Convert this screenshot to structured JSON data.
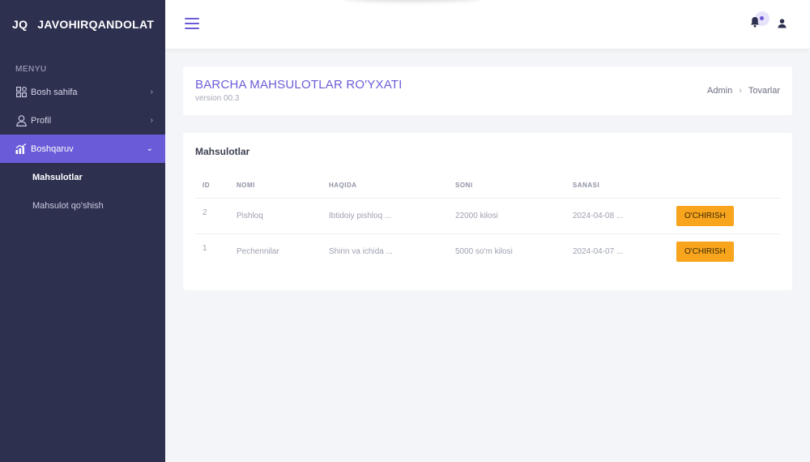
{
  "brand": {
    "abbr": "JQ",
    "name": "JAVOHIRQANDOLAT"
  },
  "sidebar": {
    "heading": "MENYU",
    "items": [
      {
        "label": "Bosh sahifa",
        "icon": "grid-icon",
        "chevron": "›"
      },
      {
        "label": "Profil",
        "icon": "user-icon",
        "chevron": "›"
      },
      {
        "label": "Boshqaruv",
        "icon": "chart-icon",
        "chevron": "⌄"
      }
    ],
    "subitems": [
      {
        "label": "Mahsulotlar"
      },
      {
        "label": "Mahsulot qo'shish"
      }
    ]
  },
  "header": {
    "title": "BARCHA MAHSULOTLAR RO'YXATI",
    "version": "version 00.3",
    "breadcrumb": [
      "Admin",
      "Tovarlar"
    ],
    "breadcrumb_sep": "›"
  },
  "products": {
    "card_title": "Mahsulotlar",
    "columns": [
      "ID",
      "NOMI",
      "HAQIDA",
      "SONI",
      "SANASI"
    ],
    "rows": [
      {
        "id": "2",
        "name": "Pishloq",
        "about": "Ibtidoiy pishloq ...",
        "qty": "22000 kilosi",
        "date": "2024-04-08 ...",
        "action": "O'CHIRISH"
      },
      {
        "id": "1",
        "name": "Pechennilar",
        "about": "Shirin va ichida ...",
        "qty": "5000 so'm kilosi",
        "date": "2024-04-07 ...",
        "action": "O'CHIRISH"
      }
    ]
  },
  "colors": {
    "sidebar_bg": "#2e3050",
    "accent": "#6a5cd8",
    "delete_btn": "#f8a41c"
  }
}
